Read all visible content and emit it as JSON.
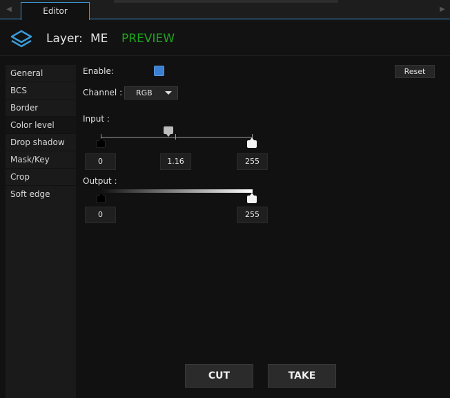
{
  "tabs": {
    "editor_label": "Editor"
  },
  "header": {
    "layer_label": "Layer:",
    "layer_name": "ME",
    "preview_label": "PREVIEW"
  },
  "sidebar": {
    "items": [
      {
        "label": "General"
      },
      {
        "label": "BCS"
      },
      {
        "label": "Border"
      },
      {
        "label": "Color level"
      },
      {
        "label": "Drop shadow"
      },
      {
        "label": "Mask/Key"
      },
      {
        "label": "Crop"
      },
      {
        "label": "Soft edge"
      }
    ],
    "active_index": 3
  },
  "panel": {
    "enable_label": "Enable:",
    "enabled": true,
    "reset_label": "Reset",
    "channel_label": "Channel :",
    "channel_value": "RGB",
    "input_label": "Input :",
    "input_black": "0",
    "input_gamma": "1.16",
    "input_white": "255",
    "output_label": "Output :",
    "output_black": "0",
    "output_white": "255"
  },
  "actions": {
    "cut_label": "CUT",
    "take_label": "TAKE"
  },
  "colors": {
    "accent": "#3a9ad9",
    "preview": "#1ea31e",
    "checkbox": "#3a7fd0"
  },
  "icons": {
    "layer": "layers-icon",
    "left": "chevron-left-icon",
    "right": "chevron-right-icon"
  }
}
